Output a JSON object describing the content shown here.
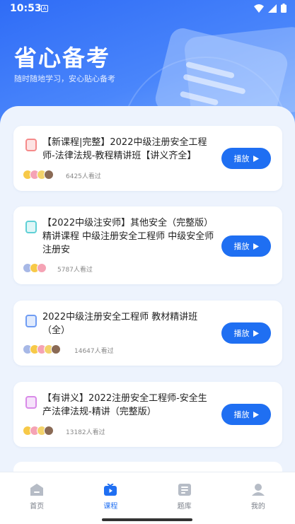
{
  "status_bar": {
    "time": "10:53",
    "notif_glyph": "A"
  },
  "header": {
    "title": "省心备考",
    "subtitle": "随时随地学习，安心贴心备考"
  },
  "courses": [
    {
      "title": "【新课程|完整】2022中级注册安全工程师-法律法规-教程精讲班【讲义齐全】",
      "play_label": "播放",
      "views": "6425人看过",
      "icon_color": "#f58a8a"
    },
    {
      "title": "【2022中级注安师】其他安全（完整版）精讲课程 中级注册安全工程师 中级安全师注册安",
      "play_label": "播放",
      "views": "5787人看过",
      "icon_color": "#5fd0d6"
    },
    {
      "title": "2022中级注册安全工程师 教材精讲班（全）",
      "play_label": "播放",
      "views": "14647人看过",
      "icon_color": "#6f9cf3"
    },
    {
      "title": "【有讲义】2022注册安全工程师-安全生产法律法规-精讲（完整版）",
      "play_label": "播放",
      "views": "13182人看过",
      "icon_color": "#d98ae8"
    }
  ],
  "tabs": [
    {
      "label": "首页",
      "icon": "home-icon",
      "active": false
    },
    {
      "label": "课程",
      "icon": "video-icon",
      "active": true
    },
    {
      "label": "题库",
      "icon": "question-bank-icon",
      "active": false
    },
    {
      "label": "我的",
      "icon": "profile-icon",
      "active": false
    }
  ],
  "colors": {
    "accent": "#1f6ff2",
    "hero_start": "#2f6cf6",
    "hero_end": "#7fb0fd",
    "content_bg": "#edf3fd",
    "inactive_tab": "#7a7f89"
  }
}
